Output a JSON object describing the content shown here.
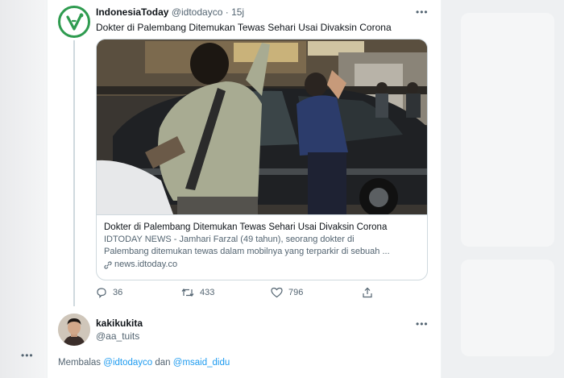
{
  "tweet": {
    "display_name": "IndonesiaToday",
    "handle": "@idtodayco",
    "separator": "·",
    "time": "15j",
    "text": "Dokter di Palembang Ditemukan Tewas Sehari Usai Divaksin Corona",
    "card": {
      "title": "Dokter di Palembang Ditemukan Tewas Sehari Usai Divaksin Corona",
      "description_line1": "IDTODAY NEWS - Jamhari Farzal (49 tahun), seorang dokter di",
      "description_line2": "Palembang ditemukan tewas dalam mobilnya yang terparkir di sebuah ...",
      "domain": "news.idtoday.co"
    },
    "actions": {
      "replies": "36",
      "retweets": "433",
      "likes": "796"
    }
  },
  "reply": {
    "display_name": "kakikukita",
    "handle": "@aa_tuits",
    "replying_label": "Membalas",
    "mention1": "@idtodayco",
    "conjunction": "dan",
    "mention2": "@msaid_didu"
  },
  "colors": {
    "link_blue": "#1d9bf0",
    "muted_text": "#536471",
    "logo_green": "#2e9b4f"
  },
  "icons": [
    "more-icon",
    "reply-icon",
    "retweet-icon",
    "like-icon",
    "share-icon",
    "link-icon"
  ]
}
